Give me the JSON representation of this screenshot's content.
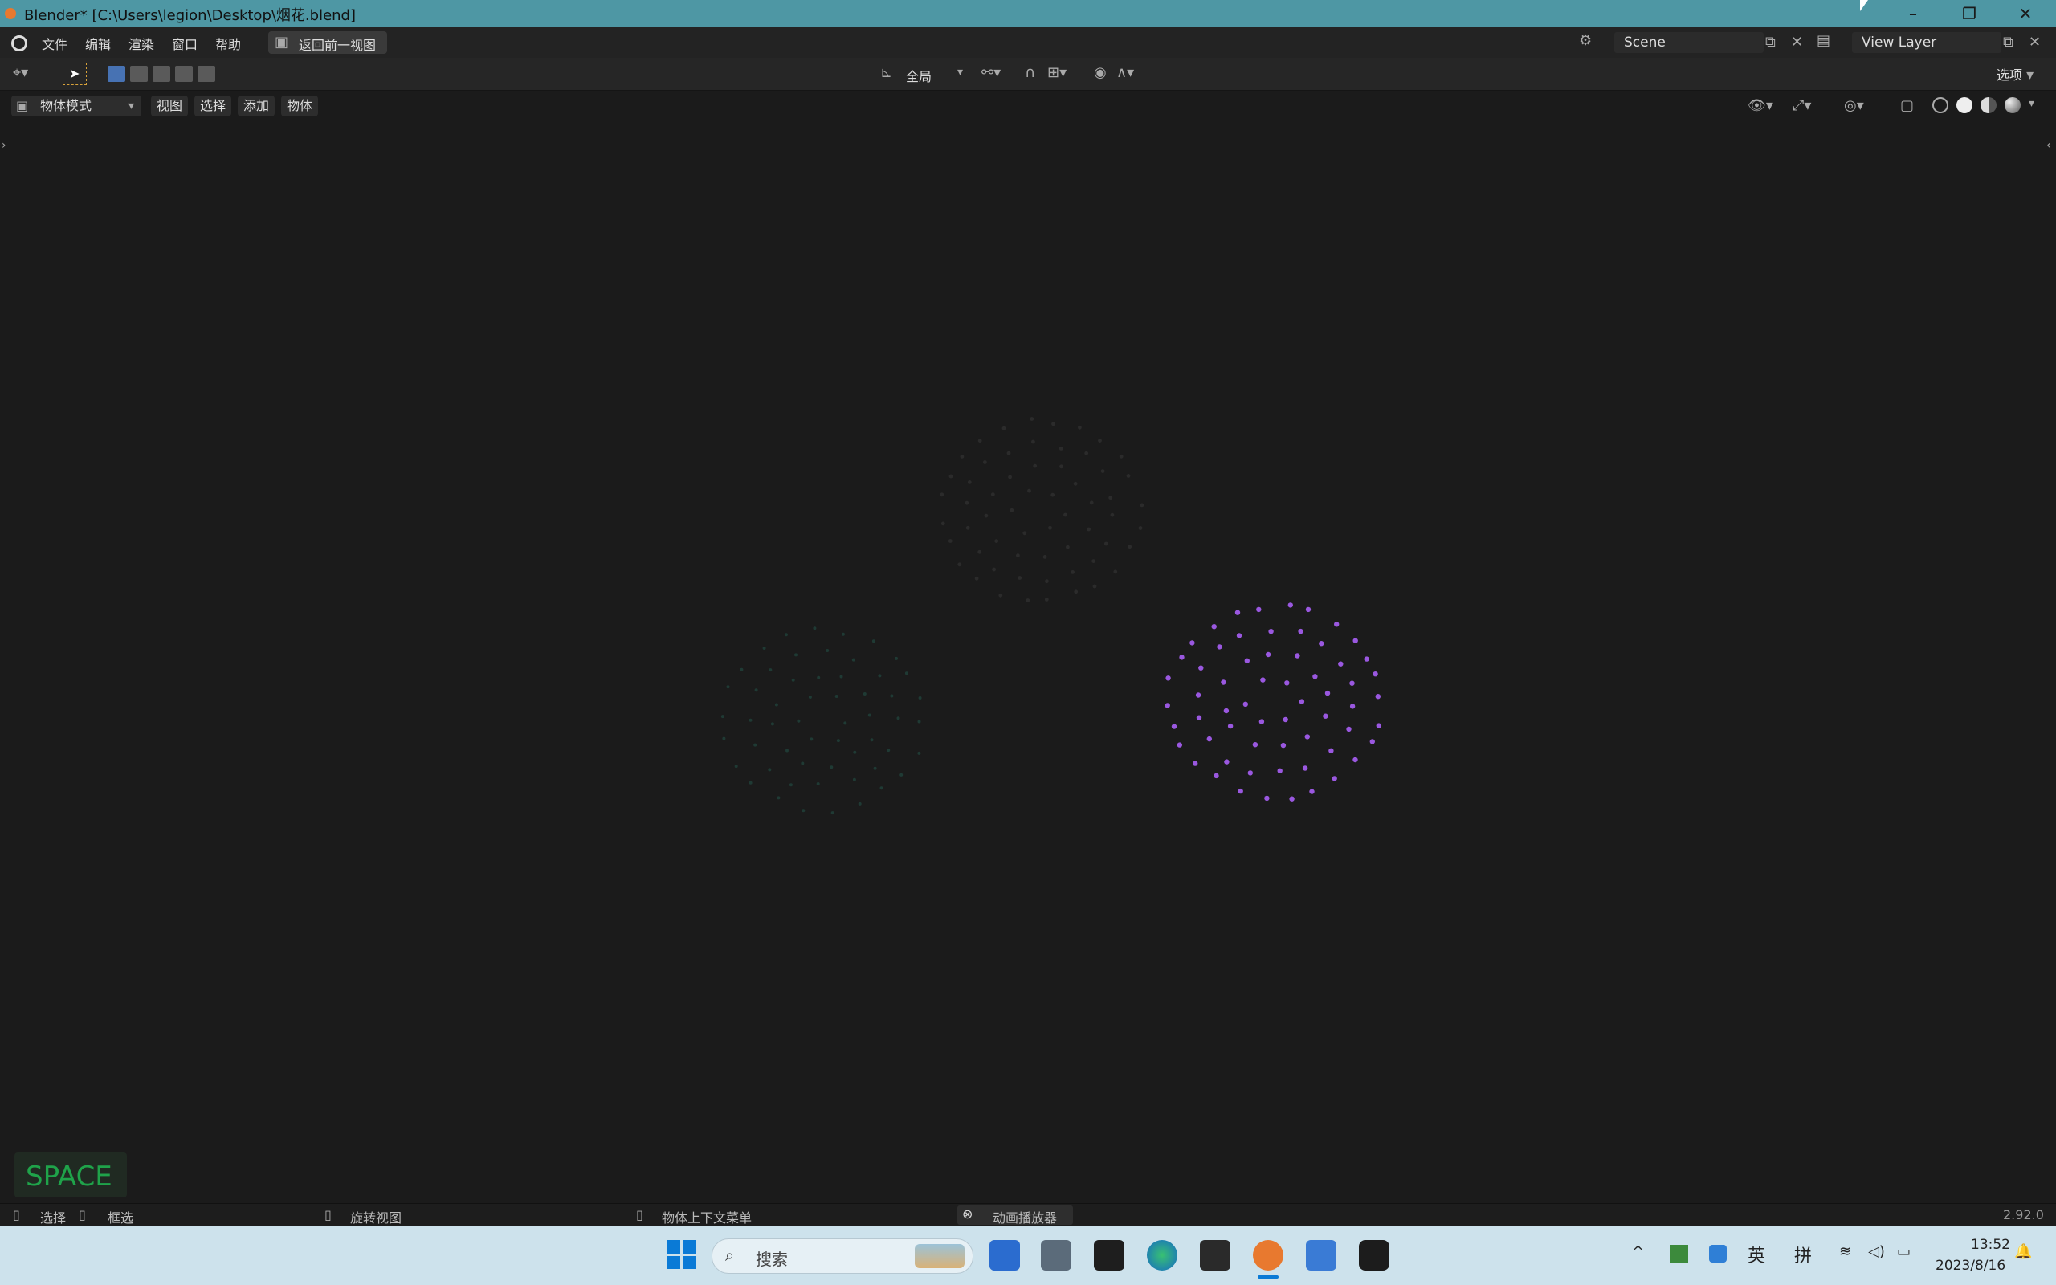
{
  "window": {
    "title": "Blender* [C:\\Users\\legion\\Desktop\\烟花.blend]",
    "minimize_glyph": "–",
    "maximize_glyph": "❐",
    "close_glyph": "✕"
  },
  "menubar": {
    "items": [
      "文件",
      "编辑",
      "渲染",
      "窗口",
      "帮助"
    ],
    "back_button": "返回前一视图",
    "scene_name": "Scene",
    "view_layer_name": "View Layer"
  },
  "tool_header": {
    "transform_orientation": "全局",
    "options_label": "选项"
  },
  "viewport_header": {
    "mode": "物体模式",
    "menus": [
      "视图",
      "选择",
      "添加",
      "物体"
    ]
  },
  "overlay": {
    "key_hint": "SPACE"
  },
  "statusbar": {
    "select": "选择",
    "box_select": "框选",
    "rotate_view": "旋转视图",
    "context_menu": "物体上下文菜单",
    "animation_player": "动画播放器",
    "version": "2.92.0"
  },
  "taskbar": {
    "search_placeholder": "搜索",
    "ime_lang": "英",
    "ime_mode": "拼",
    "time": "13:52",
    "date": "2023/8/16"
  },
  "colors": {
    "titlebar": "#4e97a4",
    "particles_purple": "#9a58e0",
    "particles_dark": "#2b2b2b",
    "particles_teal": "#1f3a34",
    "space_hint": "#1fa34a"
  }
}
